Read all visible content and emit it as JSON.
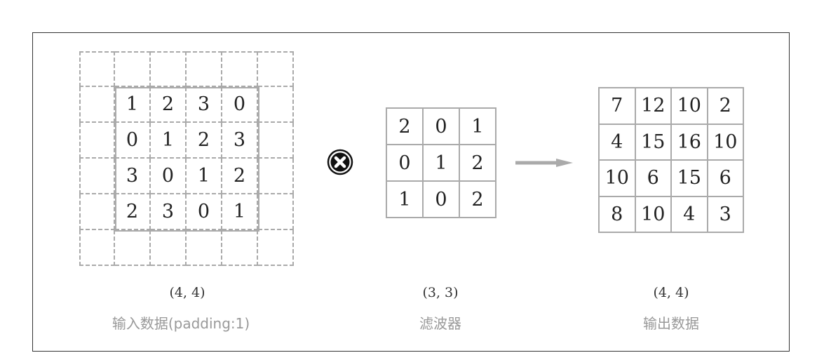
{
  "input": {
    "cells": [
      [
        "",
        "",
        "",
        "",
        "",
        ""
      ],
      [
        "",
        "1",
        "2",
        "3",
        "0",
        ""
      ],
      [
        "",
        "0",
        "1",
        "2",
        "3",
        ""
      ],
      [
        "",
        "3",
        "0",
        "1",
        "2",
        ""
      ],
      [
        "",
        "2",
        "3",
        "0",
        "1",
        ""
      ],
      [
        "",
        "",
        "",
        "",
        "",
        ""
      ]
    ],
    "shape_label": "(4, 4)",
    "caption": "输入数据(padding:1)"
  },
  "operator": {
    "icon": "convolution-circled-x-icon"
  },
  "filter": {
    "cells": [
      [
        "2",
        "0",
        "1"
      ],
      [
        "0",
        "1",
        "2"
      ],
      [
        "1",
        "0",
        "2"
      ]
    ],
    "shape_label": "(3, 3)",
    "caption": "滤波器"
  },
  "arrow": {
    "icon": "right-arrow-icon",
    "color": "#aaaaaa"
  },
  "output": {
    "cells": [
      [
        "7",
        "12",
        "10",
        "2"
      ],
      [
        "4",
        "15",
        "16",
        "10"
      ],
      [
        "10",
        "6",
        "15",
        "6"
      ],
      [
        "8",
        "10",
        "4",
        "3"
      ]
    ],
    "shape_label": "(4, 4)",
    "caption": "输出数据"
  },
  "colors": {
    "grid_line": "#aaaaaa",
    "caption_text": "#999999",
    "frame_border": "#333333"
  }
}
